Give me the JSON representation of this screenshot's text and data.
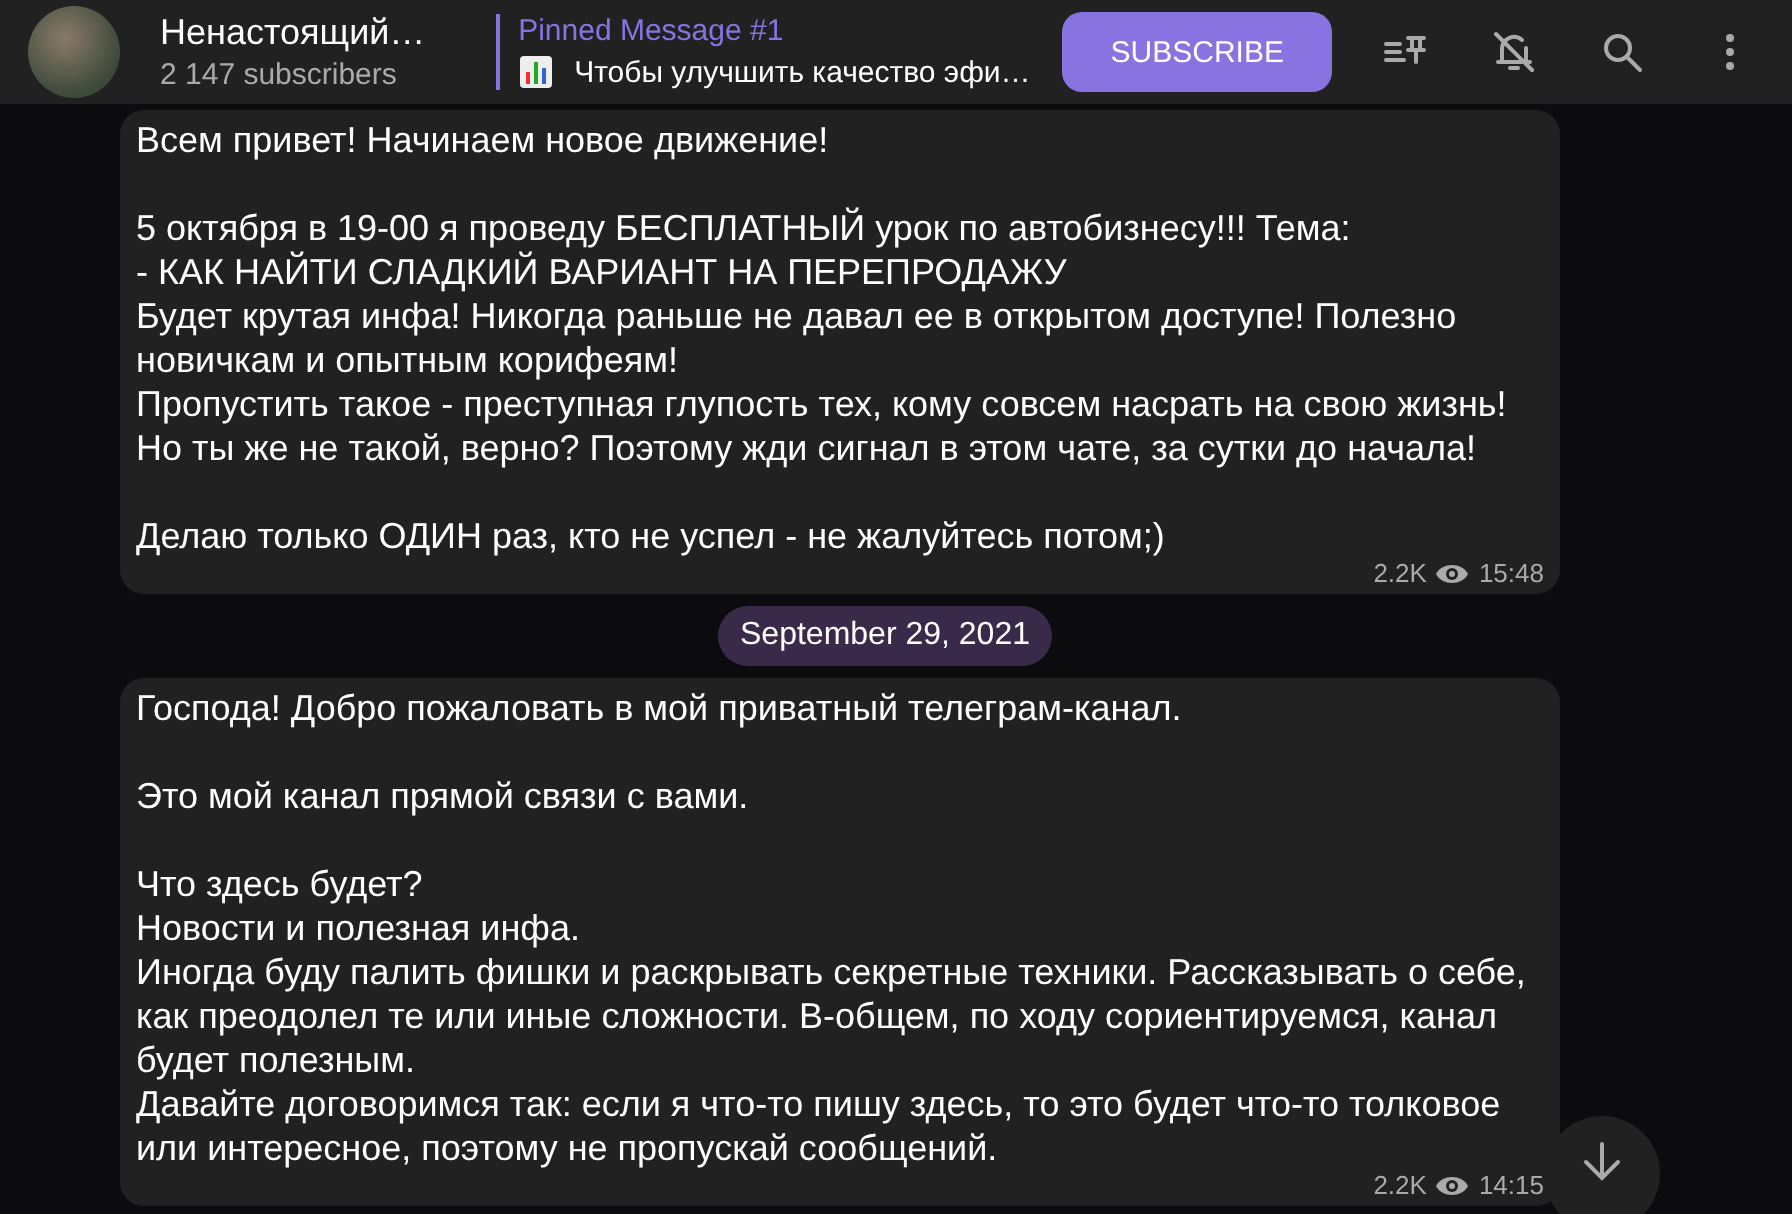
{
  "channel": {
    "name": "Ненастоящий…",
    "subscribers": "2 147 subscribers"
  },
  "pinned": {
    "title": "Pinned Message #1",
    "preview": "Чтобы улучшить качество эфи…"
  },
  "subscribe_button": "SUBSCRIBE",
  "messages": [
    {
      "kind": "message",
      "text": "Всем привет! Начинаем новое движение!\n\n5 октября в 19-00 я проведу БЕСПЛАТНЫЙ урок по автобизнесу!!! Тема:\n- КАК НАЙТИ СЛАДКИЙ ВАРИАНТ НА ПЕРЕПРОДАЖУ\nБудет крутая инфа! Никогда раньше не давал ее в открытом доступе! Полезно новичкам и опытным корифеям!\nПропустить такое - преступная глупость тех, кому совсем насрать на свою жизнь!\nНо ты же не такой, верно? Поэтому жди сигнал в этом чате, за сутки до начала!\n\nДелаю только ОДИН раз, кто не успел - не жалуйтесь потом;)",
      "views": "2.2K",
      "time": "15:48"
    },
    {
      "kind": "date",
      "text": "September 29, 2021"
    },
    {
      "kind": "message",
      "text": "Господа! Добро пожаловать в мой приватный телеграм-канал.\n\nЭто мой канал прямой связи с вами.\n\nЧто здесь будет?\nНовости и полезная инфа.\nИногда буду палить фишки и раскрывать секретные техники. Рассказывать о себе, как преодолел те или иные сложности. В-общем, по ходу сориентируемся, канал будет полезным.\nДавайте договоримся так: если я что-то пишу здесь, то это будет что-то толковое или интересное, поэтому не пропускай сообщений.",
      "views": "2.2K",
      "time": "14:15"
    }
  ]
}
